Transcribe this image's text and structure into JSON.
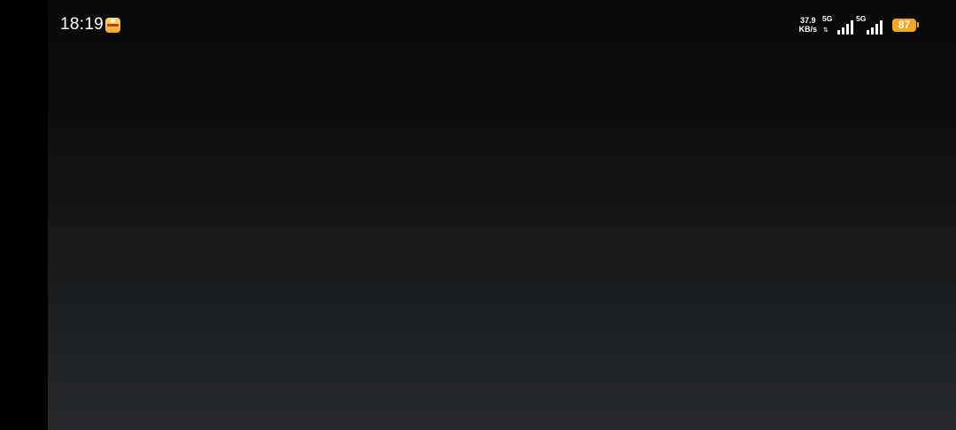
{
  "status_bar": {
    "time": "18:19",
    "notification_icon": "app-notification-icon",
    "network_speed": {
      "value": "37.9",
      "unit": "KB/s"
    },
    "sim1": {
      "network_type": "5G",
      "icon": "signal-strength-icon"
    },
    "sim2": {
      "network_type": "5G",
      "icon": "signal-strength-icon"
    },
    "battery": {
      "level": "87",
      "icon": "battery-icon",
      "color": "#F5A623"
    }
  },
  "colors": {
    "background_top": "#08090A",
    "background_bottom": "#27292C",
    "left_bar": "#000000"
  }
}
